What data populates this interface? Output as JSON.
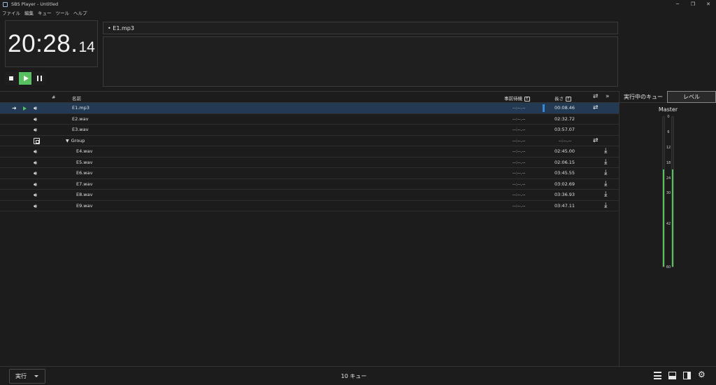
{
  "window": {
    "title": "SBS Player - Untitled",
    "controls": [
      "─",
      "❐",
      "✕"
    ]
  },
  "menu": [
    "ファイル",
    "編集",
    "キュー",
    "ツール",
    "ヘルプ"
  ],
  "clock": {
    "main": "20:28.",
    "frac": "14"
  },
  "current_cue": "• E1.mp3",
  "table": {
    "headers": {
      "number": "#",
      "name": "名前",
      "pre_wait": "事前待機",
      "duration": "長さ"
    },
    "rows": [
      {
        "name": "E1.mp3",
        "pre_wait": "--:--.--",
        "duration": "00:08.46",
        "selected": true
      },
      {
        "name": "E2.wav",
        "pre_wait": "--:--.--",
        "duration": "02:32.72"
      },
      {
        "name": "E3.wav",
        "pre_wait": "--:--.--",
        "duration": "03:57.07"
      },
      {
        "name": "Group",
        "pre_wait": "--:--.--",
        "duration": "--:--.--"
      },
      {
        "name": "E4.wav",
        "pre_wait": "--:--.--",
        "duration": "02:45.00"
      },
      {
        "name": "E5.wav",
        "pre_wait": "--:--.--",
        "duration": "02:06.15"
      },
      {
        "name": "E6.wav",
        "pre_wait": "--:--.--",
        "duration": "03:45.55"
      },
      {
        "name": "E7.wav",
        "pre_wait": "--:--.--",
        "duration": "03:02.69"
      },
      {
        "name": "E8.wav",
        "pre_wait": "--:--.--",
        "duration": "03:36.93"
      },
      {
        "name": "E9.wav",
        "pre_wait": "--:--.--",
        "duration": "03:47.11"
      }
    ]
  },
  "right_panel": {
    "tabs": [
      "実行中のキュー",
      "レベル"
    ],
    "master_label": "Master",
    "scale": [
      "0",
      "6",
      "12",
      "18",
      "24",
      "30",
      "42",
      "60"
    ],
    "meter_level_fraction": 0.65
  },
  "status": {
    "run_mode": "実行",
    "cue_count": "10 キュー"
  },
  "colors": {
    "accent_green": "#57c061",
    "selected_row": "#233a55",
    "progress_blue": "#3a86d8"
  }
}
